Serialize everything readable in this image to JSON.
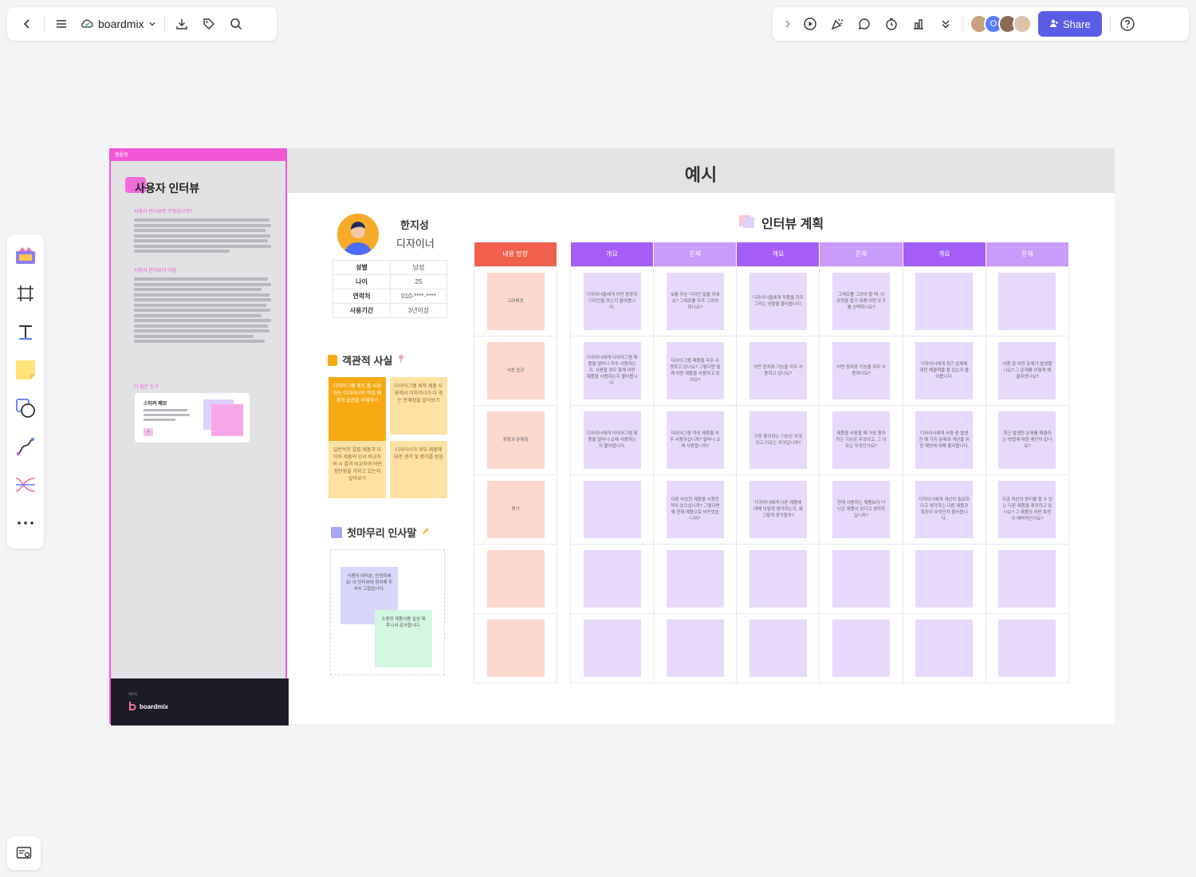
{
  "toolbar": {
    "brand": "boardmix",
    "share_label": "Share"
  },
  "avatars": [
    {
      "color": "#c7a27c"
    },
    {
      "color": "#5b7cfa",
      "letter": "O"
    },
    {
      "color": "#8b6b55"
    },
    {
      "color": "#e0c2a8"
    }
  ],
  "left_panel": {
    "tag": "템플릿",
    "title": "사용자 인터뷰",
    "sub1": "사용자 인터뷰란 무엇입니까?",
    "sub2": "사용자 인터뷰의 이점",
    "sub3": "더 많은 도구",
    "sticky_title": "스티커 메모",
    "footer_small": "제작처",
    "footer_brand": "boardmix"
  },
  "board": {
    "title": "예시",
    "profile": {
      "name": "한지성",
      "role": "디자이너",
      "rows": [
        {
          "k": "성별",
          "v": "남성"
        },
        {
          "k": "나이",
          "v": "25"
        },
        {
          "k": "연락처",
          "v": "010-****-****"
        },
        {
          "k": "사용기간",
          "v": "3년이상"
        }
      ]
    },
    "facts_title": "객관적 사실",
    "facts": [
      "다이어그램 제조 툴 사용하는 디자이너의 작업 배경과 습관을 이해하기",
      "다이어그램 제작 제품 사용에서 디자이너가 다 겪는 문제점을 알아보기",
      "일반적인 결핍 제품과 다이어 제품의 단서 비교하여 시 결과 비교하여 어떤 장단점을 가지고 있는지 알아보기",
      "디자이너가 외부 제품에 대한 생각 및 평가를 묻음"
    ],
    "closing_title": "첫마무리 인사말",
    "closing_notes": [
      "사용자 여러분, 안녕하세요! 이 인터뷰에 참여해 주셔서 고맙습니다.",
      "수용장 제품사용 실상 때 후시서 감사합니다."
    ],
    "plan_title": "인터뷰 계획",
    "plan_left_header": "내용 방향",
    "plan_left_rows": [
      "고려배경",
      "사용 습관",
      "경험과 문제점",
      "평가",
      "",
      ""
    ],
    "plan_headers": [
      "개요",
      "문제",
      "개요",
      "문제",
      "개요",
      "문제"
    ],
    "plan_rows": [
      [
        "디자이너들에게 어떤 종류의 디자인을 하는지 물어봅니다.",
        "보통 무슨 디자인 일을 하세요? 그래프를 자주 그려야 하나요?",
        "디자이너들에게 작품을 자주 그리는 상황을 물어봅니다.",
        "그래프를 그려야 할 때, 이 과정을 돕기 위해 어떤 도구를 선택하나요?",
        "",
        ""
      ],
      [
        "디자이너에게 다이어그램 제품을 얼마나 자주 사용하는지, 사용할 경우 함께 어떤 제품을 사용하는지 물어봅니다.",
        "다이어그램 제품을 자주 사용하고 있나요? 그렇다면 함께 어떤 제품을 사용하고 있어요?",
        "어떤 장치와 기능을 자주 사용하고 있나요?",
        "어떤 장치와 기능을 자주 사용하나요?",
        "디자이너에게 최근 문제에 대한 해결책을 할 있는지 물어봅니다.",
        "사용 중 어떤 문제가 발생했나요? 그 문제를 어떻게 해결하셨나요?"
      ],
      [
        "디자이너에게 다이어그램 제품을 얼마나 오래 사용하는지 물어봅니다.",
        "다이어그램 작성 제품을 자주 사용하십니까? 얼마나 오래 사용합니까?",
        "가장 좋아하는 기능은 무엇이고 이유는 무엇입니까?",
        "제품을 사용할 때 가장 좋아하는 기능은 무엇이고, 그 이유는 무엇인가요?",
        "디자이너에게 사용 중 발생한 몇 가지 문제와 개선을 위한 제안에 대해 물어봅니다.",
        "최근 발생한 문제를 해결하는 방법에 대한 제안이 있나요?"
      ],
      [
        "",
        "다른 비슷한 제품을 사용한 적이 있으십니까? 그렇다면 왜 현재 제품으로 바꾸었습니까?",
        "디자이너에게 다른 제품에 대해 어떻게 생각하는지, 왜 그렇게 생각할까?",
        "현재 사용하는 제품보다 더 나은 제품이 있다고 생각하십니까?",
        "디자이너에게 개선이 필요하다고 생각하는 다른 제품과 특징이 무엇인지 물어봅니다.",
        "지금 적산의 편리를 할 수 있는 다른 제품을 제공하고 있나요? 그 제품의 어떤 특징이 매력적인가요?"
      ],
      [
        "",
        "",
        "",
        "",
        "",
        ""
      ],
      [
        "",
        "",
        "",
        "",
        "",
        ""
      ]
    ]
  },
  "colors": {
    "accent": "#5b5ce6",
    "panel_pink": "#f257d6",
    "header_red": "#f0604d",
    "header_violet": "#a55df7",
    "header_lilac": "#c99bfa",
    "note_pink": "#fdd8cf",
    "note_purple": "#e7d9fb"
  },
  "icons": [
    "back-icon",
    "menu-icon",
    "cloud-icon",
    "chevron-down-icon",
    "download-icon",
    "tag-icon",
    "search-icon",
    "chevron-right-icon",
    "play-icon",
    "celebrate-icon",
    "comment-icon",
    "timer-icon",
    "vote-icon",
    "more-down-icon",
    "share-user-icon",
    "help-icon"
  ]
}
